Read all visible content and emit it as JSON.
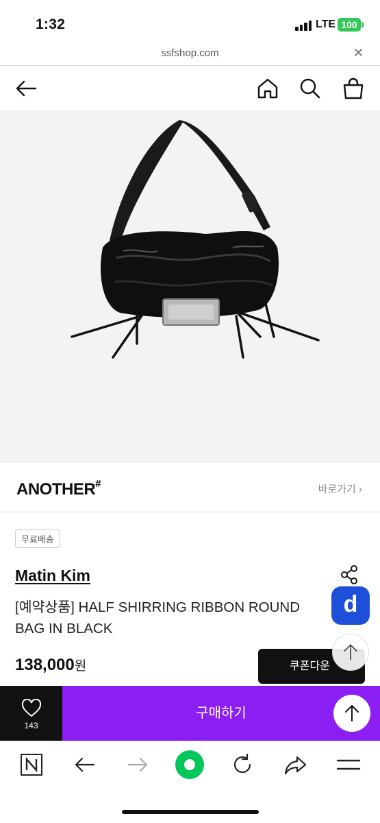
{
  "status": {
    "time": "1:32",
    "network": "LTE",
    "battery": "100"
  },
  "browser": {
    "url": "ssfshop.com",
    "close_glyph": "✕"
  },
  "header": {
    "icons": [
      "back-arrow-icon",
      "home-icon",
      "search-icon",
      "shopping-bag-icon"
    ]
  },
  "product": {
    "image_alt": "black leather shirring ribbon round bag",
    "brand_logo": "ANOTHER",
    "brand_logo_mark": "#",
    "brand_link": "바로가기 ›",
    "badge": "무료배송",
    "maker": "Matin Kim",
    "name": "[예약상품] HALF SHIRRING RIBBON ROUND BAG IN BLACK",
    "price": "138,000",
    "price_unit": "원",
    "coupon_label": "쿠폰다운"
  },
  "floating": {
    "d_label": "d"
  },
  "buy_bar": {
    "wish_count": "143",
    "buy_label": "구매하기"
  },
  "colors": {
    "buy": "#8b1ef2",
    "d_badge": "#1e4fd8",
    "battery": "#34c759",
    "naver_green": "#03c75a"
  },
  "browser_nav": {
    "icons": [
      "naver-n-icon",
      "back-icon",
      "forward-icon",
      "green-dot-icon",
      "refresh-icon",
      "share-icon",
      "menu-icon"
    ]
  }
}
